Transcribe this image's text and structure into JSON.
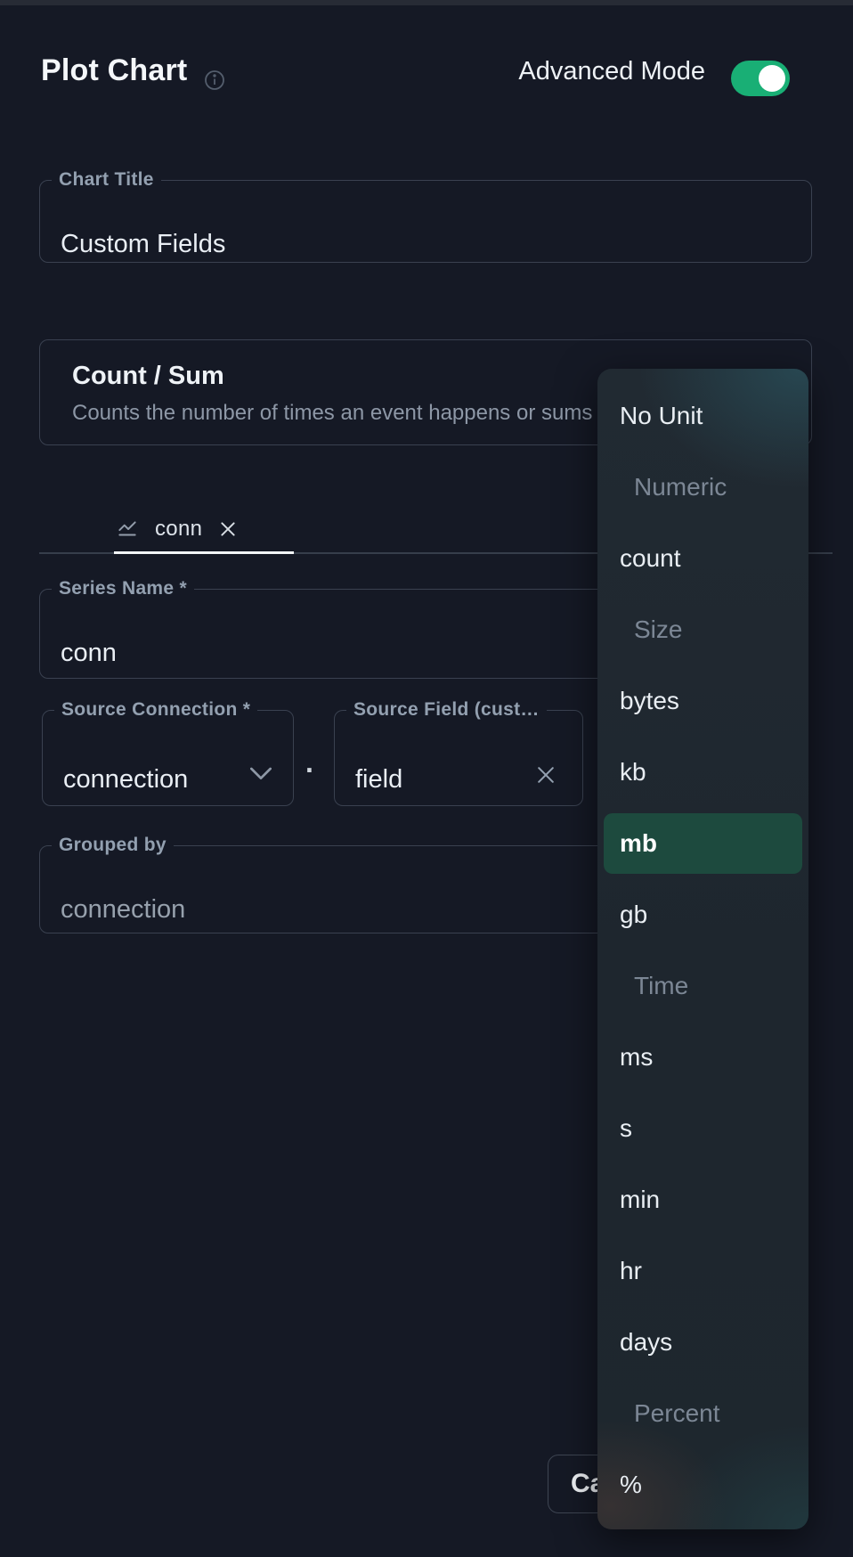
{
  "header": {
    "title": "Plot Chart",
    "advanced_mode_label": "Advanced Mode",
    "advanced_mode_on": true
  },
  "form": {
    "chart_title": {
      "label": "Chart Title",
      "value": "Custom Fields"
    },
    "aggregation_card": {
      "title": "Count / Sum",
      "description": "Counts the number of times an event happens or sums"
    },
    "series_tab": {
      "label": "conn"
    },
    "series_name": {
      "label": "Series Name *",
      "value": "conn"
    },
    "source_connection": {
      "label": "Source Connection *",
      "value": "connection"
    },
    "separator": ".",
    "source_field": {
      "label": "Source Field (cust…",
      "value": "field"
    },
    "grouped_by": {
      "label": "Grouped by",
      "value": "connection"
    }
  },
  "footer": {
    "cancel_label": "Ca"
  },
  "unit_menu": {
    "items": [
      {
        "label": "No Unit",
        "type": "item"
      },
      {
        "label": "Numeric",
        "type": "header"
      },
      {
        "label": "count",
        "type": "item"
      },
      {
        "label": "Size",
        "type": "header"
      },
      {
        "label": "bytes",
        "type": "item"
      },
      {
        "label": "kb",
        "type": "item"
      },
      {
        "label": "mb",
        "type": "item",
        "selected": true
      },
      {
        "label": "gb",
        "type": "item"
      },
      {
        "label": "Time",
        "type": "header"
      },
      {
        "label": "ms",
        "type": "item"
      },
      {
        "label": "s",
        "type": "item"
      },
      {
        "label": "min",
        "type": "item"
      },
      {
        "label": "hr",
        "type": "item"
      },
      {
        "label": "days",
        "type": "item"
      },
      {
        "label": "Percent",
        "type": "header"
      },
      {
        "label": "%",
        "type": "item"
      }
    ]
  },
  "colors": {
    "background": "#151925",
    "field_border": "#3a4150",
    "label_text": "#93a0b0",
    "toggle_on_green": "#19af75",
    "selected_item_green": "#1d4a3e"
  }
}
